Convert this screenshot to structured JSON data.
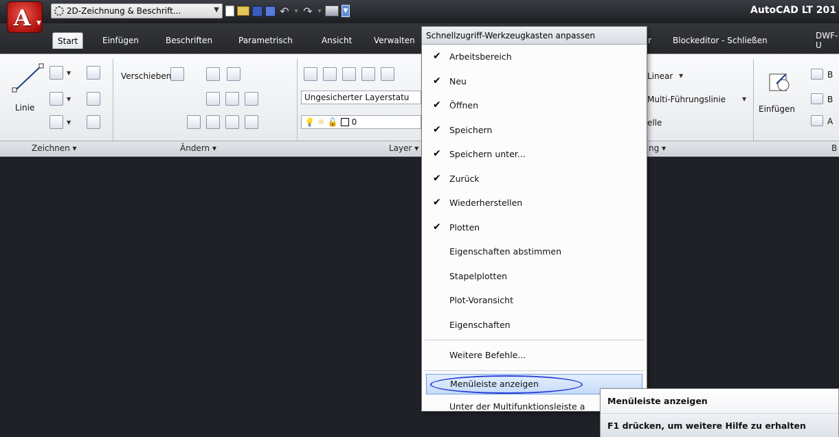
{
  "app": {
    "title": "AutoCAD LT 201",
    "menu_button_glyph": "A",
    "workspace": "2D-Zeichnung & Beschrift...",
    "accent": "#b3130f"
  },
  "tabs": [
    {
      "label": "Start",
      "active": true
    },
    {
      "label": "Einfügen"
    },
    {
      "label": "Beschriften"
    },
    {
      "label": "Parametrisch"
    },
    {
      "label": "Ansicht"
    },
    {
      "label": "Verwalten"
    },
    {
      "label": "r"
    },
    {
      "label": "Blockeditor - Schließen"
    },
    {
      "label": "DWF-U"
    }
  ],
  "ribbon": {
    "line_label": "Linie",
    "move_label": "Verschieben",
    "layer_state": "Ungesicherter Layerstatu",
    "layer_value": "0",
    "linear_label": "Linear",
    "multileader_label": "Multi-Führungslinie",
    "table_label": "elle",
    "insert_label": "Einfügen",
    "b1": "B",
    "b2": "B",
    "b3": "A",
    "panels": {
      "draw": "Zeichnen",
      "modify": "Ändern",
      "layer": "Layer",
      "annotation": "ng",
      "block": "B"
    }
  },
  "menu": {
    "header": "Schnellzugriff-Werkzeugkasten anpassen",
    "items": [
      {
        "label": "Arbeitsbereich",
        "checked": true
      },
      {
        "label": "Neu",
        "checked": true
      },
      {
        "label": "Öffnen",
        "checked": true
      },
      {
        "label": "Speichern",
        "checked": true
      },
      {
        "label": "Speichern unter...",
        "checked": true
      },
      {
        "label": "Zurück",
        "checked": true
      },
      {
        "label": "Wiederherstellen",
        "checked": true
      },
      {
        "label": "Plotten",
        "checked": true
      },
      {
        "label": "Eigenschaften abstimmen",
        "checked": false
      },
      {
        "label": "Stapelplotten",
        "checked": false
      },
      {
        "label": "Plot-Voransicht",
        "checked": false
      },
      {
        "label": "Eigenschaften",
        "checked": false
      }
    ],
    "more_commands": "Weitere Befehle...",
    "show_menubar": "Menüleiste anzeigen",
    "below_ribbon": "Unter der Multifunktionsleiste a"
  },
  "tooltip": {
    "title": "Menüleiste anzeigen",
    "help": "F1 drücken, um weitere Hilfe zu erhalten"
  }
}
